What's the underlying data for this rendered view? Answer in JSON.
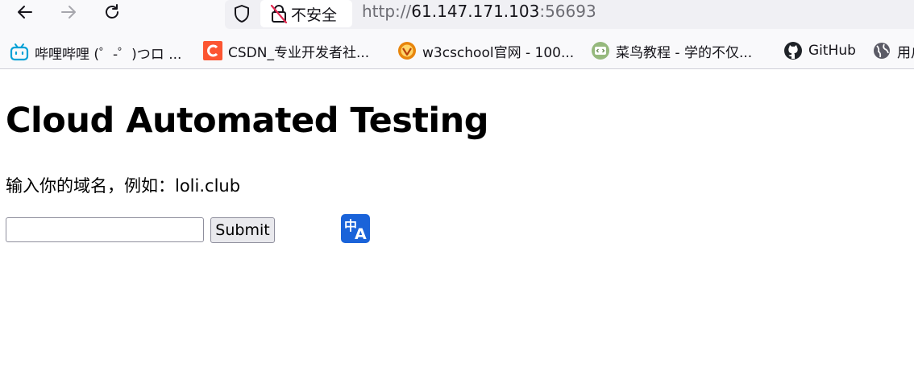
{
  "browser": {
    "security_label": "不安全",
    "url": {
      "scheme": "http://",
      "host": "61.147.171.103",
      "port": ":56693"
    }
  },
  "bookmarks": [
    {
      "label": "哔哩哔哩 (゜-゜)つロ ...",
      "icon": "bilibili-icon",
      "color": "#00a1d6"
    },
    {
      "label": "CSDN_专业开发者社...",
      "icon": "csdn-icon",
      "color": "#fc5531"
    },
    {
      "label": "w3cschool官网 - 100...",
      "icon": "w3cschool-icon",
      "color": "#e8850c"
    },
    {
      "label": "菜鸟教程 - 学的不仅...",
      "icon": "runoob-icon",
      "color": "#96b97d"
    },
    {
      "label": "GitHub",
      "icon": "github-icon",
      "color": "#1f2328"
    },
    {
      "label": "用户",
      "icon": "globe-icon",
      "color": "#5b5b66"
    }
  ],
  "page": {
    "title": "Cloud Automated Testing",
    "instruction": "输入你的域名，例如：loli.club",
    "input_value": "",
    "submit_label": "Submit",
    "translate_icon": {
      "zh": "中",
      "en": "A"
    }
  }
}
